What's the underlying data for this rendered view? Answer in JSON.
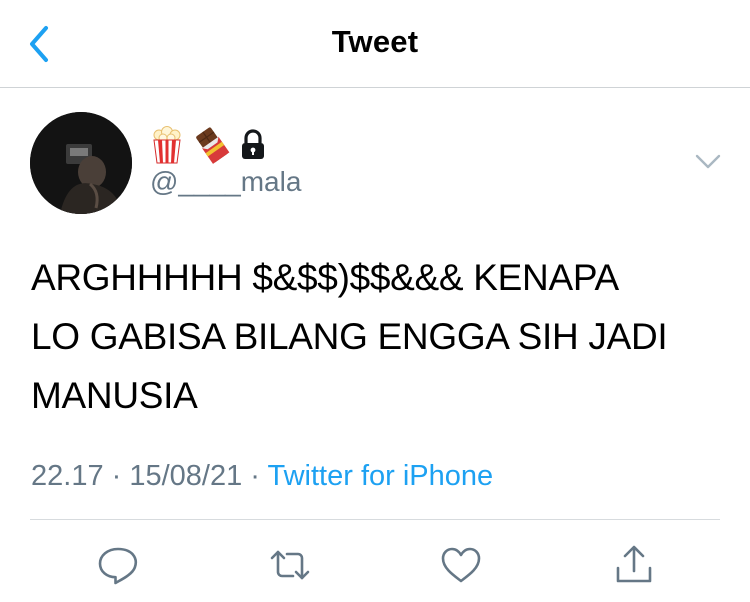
{
  "header": {
    "title": "Tweet",
    "back_icon": "chevron-left-icon"
  },
  "tweet": {
    "display_emojis": [
      "popcorn-emoji",
      "chocolate-bar-emoji",
      "lock-icon"
    ],
    "handle": "@____mala",
    "text_lines": [
      "ARGHHHHH $&$$)$$&&& KENAPA",
      "LO GABISA BILANG ENGGA SIH JADI",
      "MANUSIA"
    ],
    "time": "22.17",
    "date": "15/08/21",
    "separator": " · ",
    "source": "Twitter for iPhone"
  },
  "actions": [
    "reply-icon",
    "retweet-icon",
    "like-icon",
    "share-icon"
  ],
  "colors": {
    "accent": "#1da1f2",
    "secondary_text": "#657786",
    "icon_gray": "#657786",
    "divider": "#d7dbde"
  }
}
